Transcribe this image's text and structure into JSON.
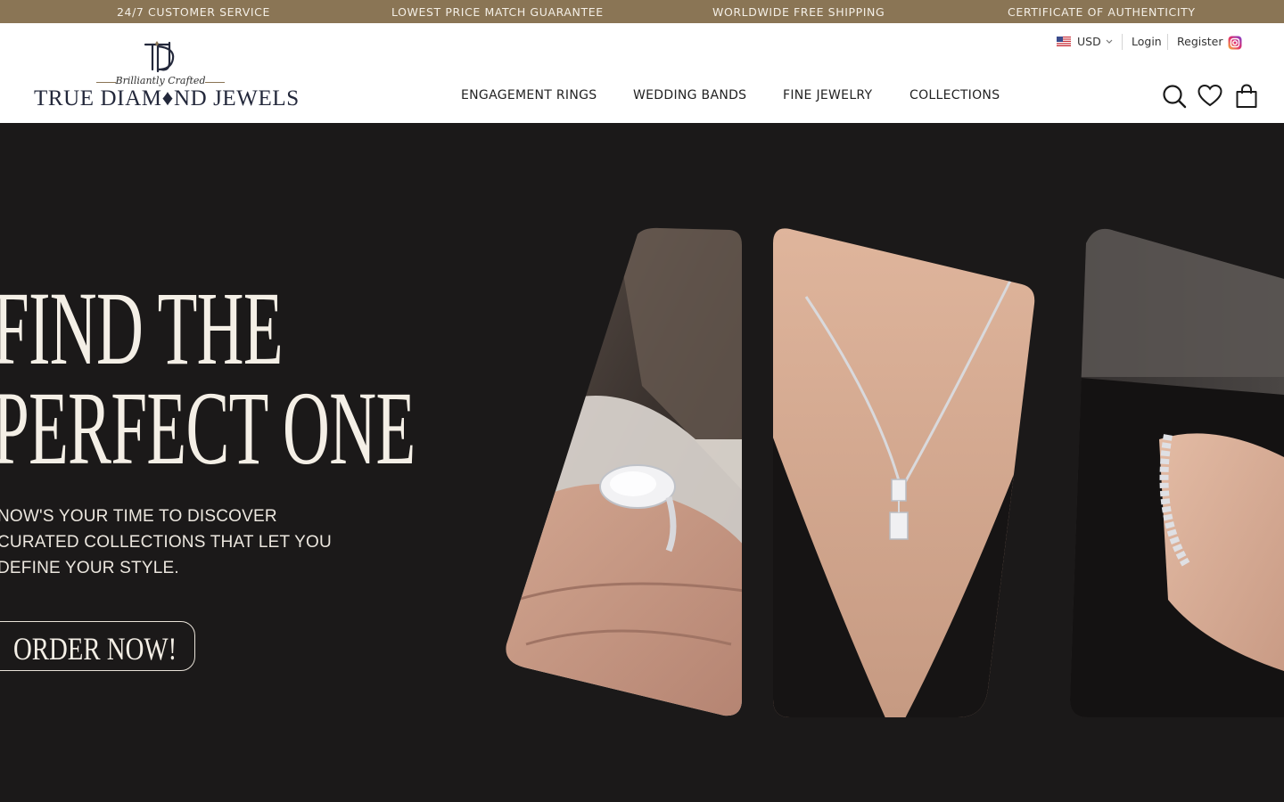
{
  "announcements": [
    "24/7 CUSTOMER SERVICE",
    "LOWEST PRICE MATCH GUARANTEE",
    "WORLDWIDE FREE SHIPPING",
    "CERTIFICATE OF AUTHENTICITY"
  ],
  "logo": {
    "monogram": "TDJ",
    "tagline": "Brilliantly Crafted",
    "wordmark": "TRUE DIAM♦ND JEWELS"
  },
  "utility": {
    "currency": "USD",
    "login": "Login",
    "register": "Register"
  },
  "nav": [
    "ENGAGEMENT RINGS",
    "WEDDING BANDS",
    "FINE JEWELRY",
    "COLLECTIONS"
  ],
  "header_icons": [
    "search-icon",
    "heart-icon",
    "shopping-bag-icon",
    "instagram-icon",
    "us-flag-icon",
    "chevron-down-icon"
  ],
  "hero": {
    "headline_line1": "FIND THE",
    "headline_line2": "PERFECT ONE",
    "subtext": [
      "NOW'S YOUR TIME TO DISCOVER",
      "CURATED COLLECTIONS THAT LET YOU",
      "DEFINE YOUR STYLE."
    ],
    "cta": "ORDER NOW!"
  },
  "colors": {
    "announcement_bar": "#8a7555",
    "hero_background": "#1b1919",
    "hero_text": "#f4efe6",
    "brand_navy": "#23283b"
  }
}
